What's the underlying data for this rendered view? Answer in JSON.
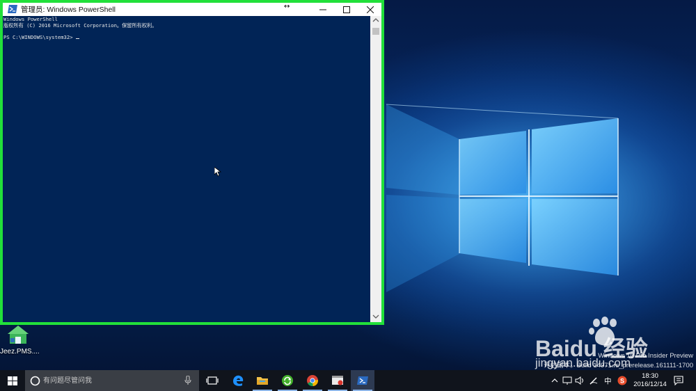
{
  "window": {
    "title": "管理员: Windows PowerShell",
    "console_lines": [
      "Windows PowerShell",
      "版权所有 (C) 2016 Microsoft Corporation。保留所有权利。",
      "",
      "PS C:\\WINDOWS\\system32> "
    ]
  },
  "desktop": {
    "icon_label": "Jeez.PMS...."
  },
  "edition": {
    "line1": "Windows 10 Pro Insider Preview",
    "line2": "评估副本。Build 14971.rs_prerelease.161111-1700"
  },
  "watermark": {
    "brand": "Baidu 经验",
    "url": "jingyan.baidu.com"
  },
  "taskbar": {
    "search_placeholder": "有问题尽管问我",
    "apps": [
      "task-view",
      "edge",
      "file-explorer",
      "green-app",
      "chrome",
      "app-window",
      "powershell"
    ],
    "ime": "中",
    "time": "18:30",
    "date": "2016/12/14"
  },
  "colors": {
    "console_bg": "#012456",
    "window_border": "#22e03a",
    "taskbar_bg": "#10141c"
  }
}
